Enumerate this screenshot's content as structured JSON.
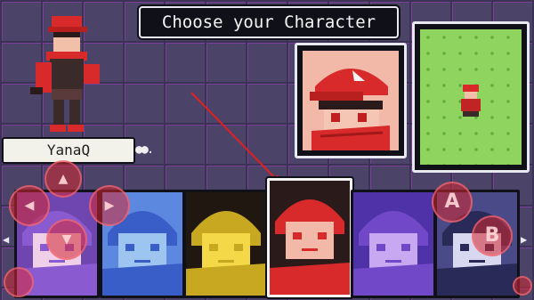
{
  "screen": {
    "title": "Choose your Character",
    "player_name": "YanaQ",
    "name_dots": "●●.",
    "nav_left": "◀",
    "nav_right": "▶"
  },
  "selected_index": 3,
  "characters": [
    {
      "id": "char-1",
      "palette": [
        "#8a5ad0",
        "#efd0e8",
        "#6f45b0"
      ]
    },
    {
      "id": "char-2",
      "palette": [
        "#3a5ec8",
        "#9ec4f0",
        "#5d88e0"
      ]
    },
    {
      "id": "char-3",
      "palette": [
        "#c8a820",
        "#f4d848",
        "#201810"
      ]
    },
    {
      "id": "char-4",
      "palette": [
        "#d82a2a",
        "#f2b8a8",
        "#2a1a1a"
      ]
    },
    {
      "id": "char-5",
      "palette": [
        "#7048c8",
        "#c8a8f0",
        "#5032a8"
      ]
    },
    {
      "id": "char-6",
      "palette": [
        "#2a2a58",
        "#d8d8f0",
        "#4a4a88"
      ]
    }
  ],
  "overlay": {
    "dpad_up": "▲",
    "dpad_down": "▼",
    "dpad_left": "◀",
    "dpad_right": "▶",
    "button_a": "A",
    "button_b": "B"
  },
  "colors": {
    "overlay_red": "#d62832",
    "accent_red": "#e02020",
    "grass": "#8ed45e"
  }
}
